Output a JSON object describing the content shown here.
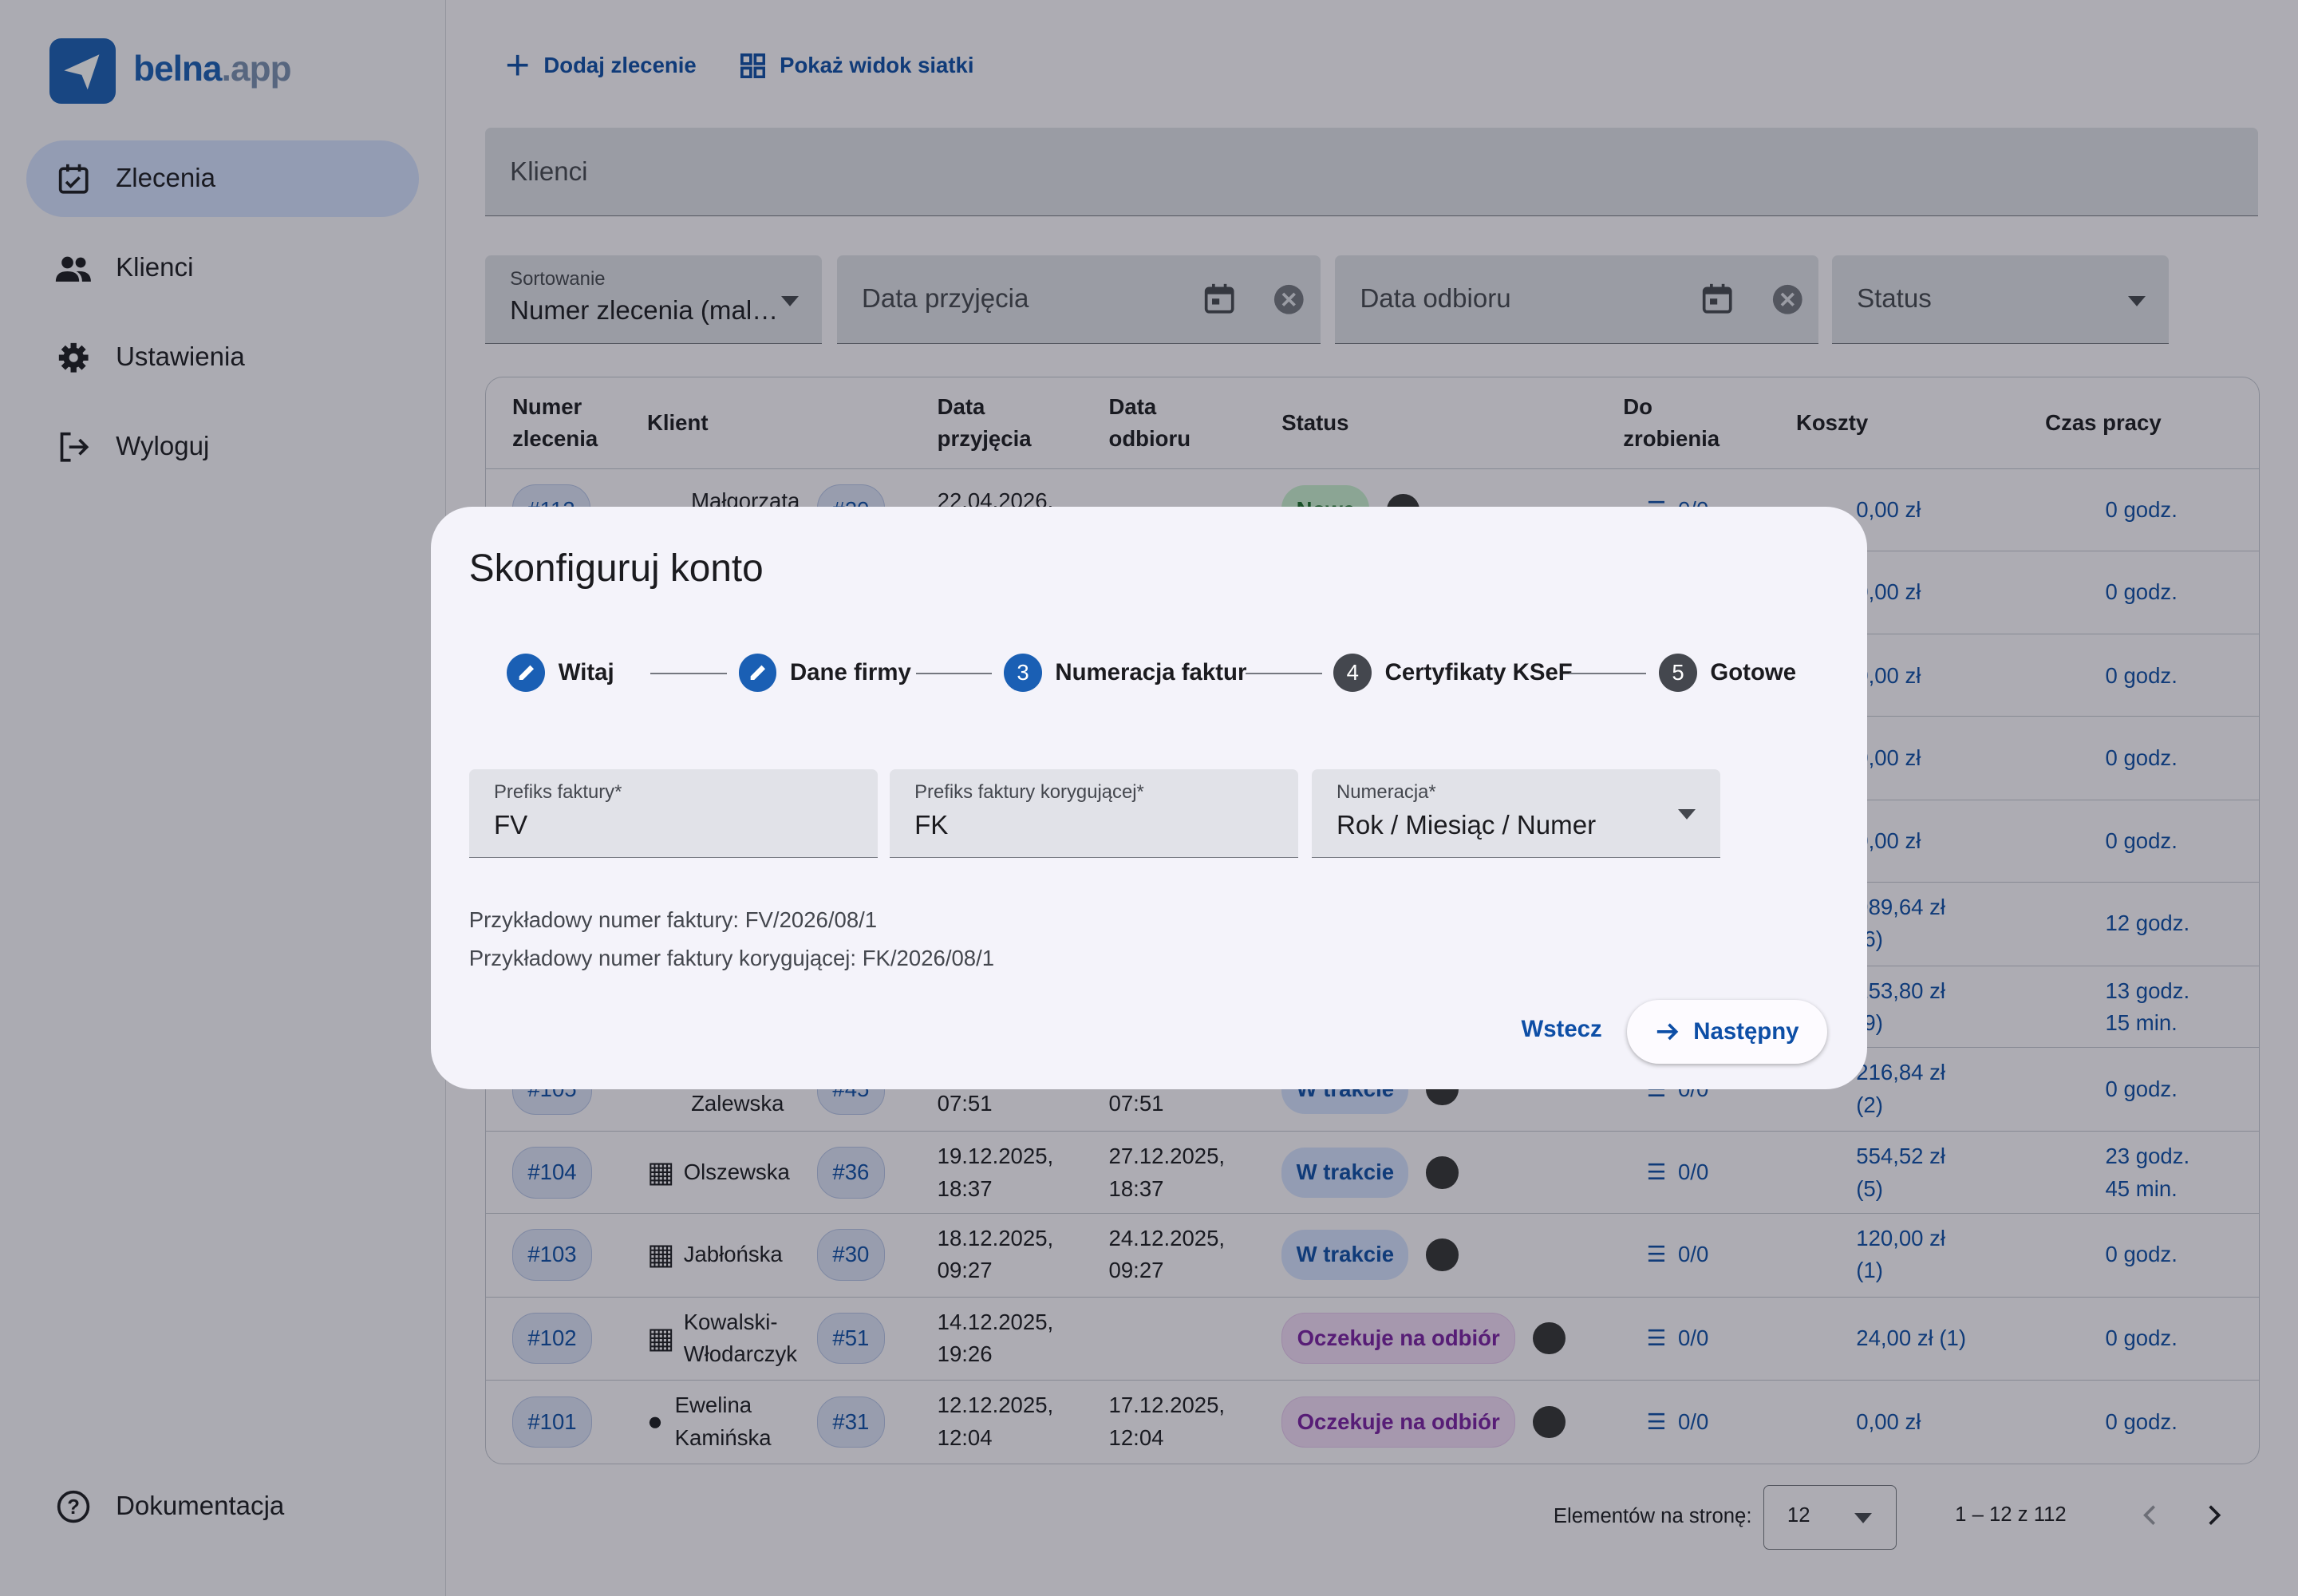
{
  "app": {
    "logo_main": "belna",
    "logo_tld": ".app"
  },
  "nav": {
    "zlecenia": "Zlecenia",
    "klienci": "Klienci",
    "ustawienia": "Ustawienia",
    "wyloguj": "Wyloguj",
    "dokumentacja": "Dokumentacja"
  },
  "toolbar": {
    "add": "Dodaj zlecenie",
    "grid": "Pokaż widok siatki"
  },
  "search": {
    "placeholder": "Klienci"
  },
  "filters": {
    "sort_label": "Sortowanie",
    "sort_value": "Numer zlecenia (mal…",
    "date_in": "Data przyjęcia",
    "date_out": "Data odbioru",
    "status": "Status"
  },
  "table": {
    "headers": {
      "numer": "Numer zlecenia",
      "klient": "Klient",
      "przyjecia": "Data przyjęcia",
      "odbioru": "Data odbioru",
      "status": "Status",
      "dozrobienia": "Do zrobienia",
      "koszty": "Koszty",
      "czas": "Czas pracy"
    },
    "rows": [
      {
        "num": "#112",
        "client": "Małgorzata",
        "cid": "#20",
        "in": "22.04.2026,",
        "out": "",
        "status": "Nowe",
        "todo": "0/0",
        "cost": "0,00 zł",
        "time": "0 godz."
      },
      {
        "num": "",
        "client": "",
        "cid": "",
        "in": "",
        "out": "",
        "status": "",
        "todo": "",
        "cost": "0,00 zł",
        "time": "0 godz."
      },
      {
        "num": "",
        "client": "",
        "cid": "",
        "in": "",
        "out": "",
        "status": "",
        "todo": "",
        "cost": "0,00 zł",
        "time": "0 godz."
      },
      {
        "num": "",
        "client": "",
        "cid": "",
        "in": "",
        "out": "",
        "status": "",
        "todo": "",
        "cost": "0,00 zł",
        "time": "0 godz."
      },
      {
        "num": "",
        "client": "",
        "cid": "",
        "in": "",
        "out": "",
        "status": "",
        "todo": "",
        "cost": "0,00 zł",
        "time": "0 godz."
      },
      {
        "num": "",
        "client": "",
        "cid": "",
        "in": "",
        "out": "",
        "status": "",
        "todo": "",
        "cost": "989,64 zł (6)",
        "time": "12 godz."
      },
      {
        "num": "",
        "client": "",
        "cid": "",
        "in": "",
        "out": "",
        "status": "",
        "todo": "",
        "cost": "153,80 zł (9)",
        "time": "13 godz. 15 min."
      },
      {
        "num": "#105",
        "client": "Zalewska",
        "cid": "#45",
        "in": "07:51",
        "out": "07:51",
        "status": "W trakcie",
        "todo": "0/0",
        "cost": "216,84 zł (2)",
        "time": "0 godz."
      },
      {
        "num": "#104",
        "client": "Olszewska",
        "cid": "#36",
        "in": "19.12.2025, 18:37",
        "out": "27.12.2025, 18:37",
        "status": "W trakcie",
        "todo": "0/0",
        "cost": "554,52 zł (5)",
        "time": "23 godz. 45 min."
      },
      {
        "num": "#103",
        "client": "Jabłońska",
        "cid": "#30",
        "in": "18.12.2025, 09:27",
        "out": "24.12.2025, 09:27",
        "status": "W trakcie",
        "todo": "0/0",
        "cost": "120,00 zł (1)",
        "time": "0 godz."
      },
      {
        "num": "#102",
        "client": "Kowalski-Włodarczyk",
        "cid": "#51",
        "in": "14.12.2025, 19:26",
        "out": "",
        "status": "Oczekuje na odbiór",
        "todo": "0/0",
        "cost": "24,00 zł (1)",
        "time": "0 godz."
      },
      {
        "num": "#101",
        "client": "Ewelina Kamińska",
        "cid": "#31",
        "in": "12.12.2025, 12:04",
        "out": "17.12.2025, 12:04",
        "status": "Oczekuje na odbiór",
        "todo": "0/0",
        "cost": "0,00 zł",
        "time": "0 godz."
      }
    ]
  },
  "pager": {
    "label": "Elementów na stronę:",
    "size": "12",
    "range": "1 – 12 z 112"
  },
  "dialog": {
    "title": "Skonfiguruj konto",
    "steps": [
      {
        "num": "",
        "label": "Witaj",
        "state": "done"
      },
      {
        "num": "",
        "label": "Dane firmy",
        "state": "done"
      },
      {
        "num": "3",
        "label": "Numeracja faktur",
        "state": "current"
      },
      {
        "num": "4",
        "label": "Certyfikaty KSeF",
        "state": "todo"
      },
      {
        "num": "5",
        "label": "Gotowe",
        "state": "todo"
      }
    ],
    "prefix_label": "Prefiks faktury*",
    "prefix_value": "FV",
    "corr_label": "Prefiks faktury korygującej*",
    "corr_value": "FK",
    "numbering_label": "Numeracja*",
    "numbering_value": "Rok / Miesiąc / Numer",
    "example1": "Przykładowy numer faktury: FV/2026/08/1",
    "example2": "Przykładowy numer faktury korygującej: FK/2026/08/1",
    "back": "Wstecz",
    "next": "Następny"
  },
  "colors": {
    "accent": "#1a5fb4",
    "accent_text": "#0d4ea6"
  }
}
